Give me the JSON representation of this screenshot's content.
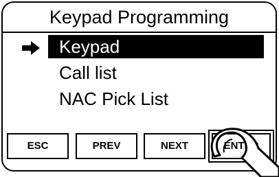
{
  "title": "Keypad Programming",
  "menu": {
    "selected_index": 0,
    "items": [
      {
        "label": "Keypad"
      },
      {
        "label": "Call list"
      },
      {
        "label": "NAC Pick List"
      }
    ]
  },
  "buttons": {
    "esc": "ESC",
    "prev": "PREV",
    "next": "NEXT",
    "enter": "ENTER"
  },
  "icons": {
    "selection_pointer": "right-arrow-icon",
    "pressing_finger": "finger-press-icon"
  },
  "colors": {
    "background": "#ffffff",
    "ink": "#000000",
    "selected_text": "#ffffff"
  }
}
